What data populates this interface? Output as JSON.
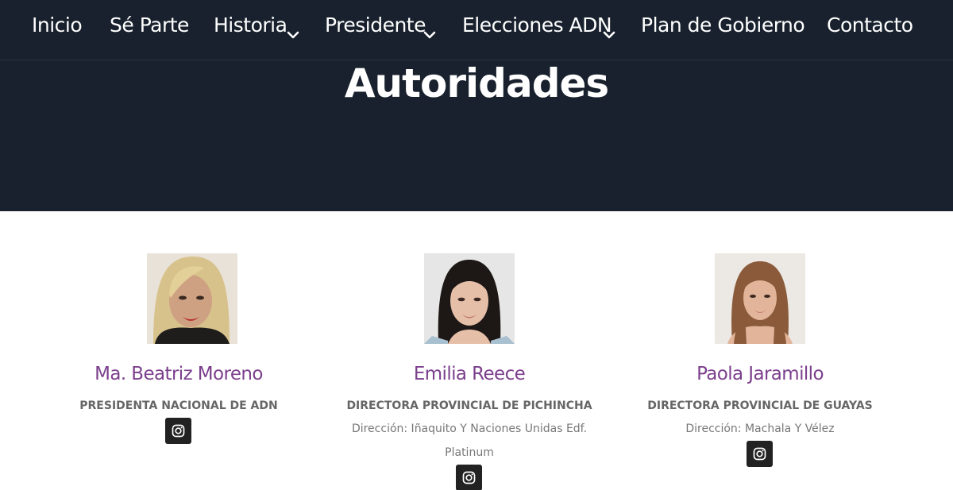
{
  "nav": {
    "items": [
      {
        "label": "Inicio"
      },
      {
        "label": "Sé Parte"
      },
      {
        "label": "Historia",
        "icon": "chevron-down-icon"
      },
      {
        "label": "Presidente",
        "icon": "chevron-down-icon"
      },
      {
        "label": "Elecciones ADN",
        "icon": "chevron-down-icon"
      },
      {
        "label": "Plan de Gobierno"
      },
      {
        "label": "Contacto"
      }
    ]
  },
  "page": {
    "title": "Autoridades"
  },
  "authorities": [
    {
      "name": "Ma. Beatriz Moreno",
      "role": "PRESIDENTA NACIONAL DE ADN",
      "address_lines": [],
      "social_icon": "instagram-icon"
    },
    {
      "name": "Emilia Reece",
      "role": "DIRECTORA PROVINCIAL DE PICHINCHA",
      "address_lines": [
        "Dirección: Iñaquito Y Naciones Unidas Edf.",
        "Platinum"
      ],
      "social_icon": "instagram-icon"
    },
    {
      "name": "Paola Jaramillo",
      "role": "DIRECTORA PROVINCIAL DE GUAYAS",
      "address_lines": [
        "Dirección: Machala Y Vélez"
      ],
      "social_icon": "instagram-icon"
    }
  ],
  "colors": {
    "header_background": "#18212d",
    "name_accent": "#7b3f8c",
    "role_text": "#666666",
    "social_button": "#222222"
  }
}
